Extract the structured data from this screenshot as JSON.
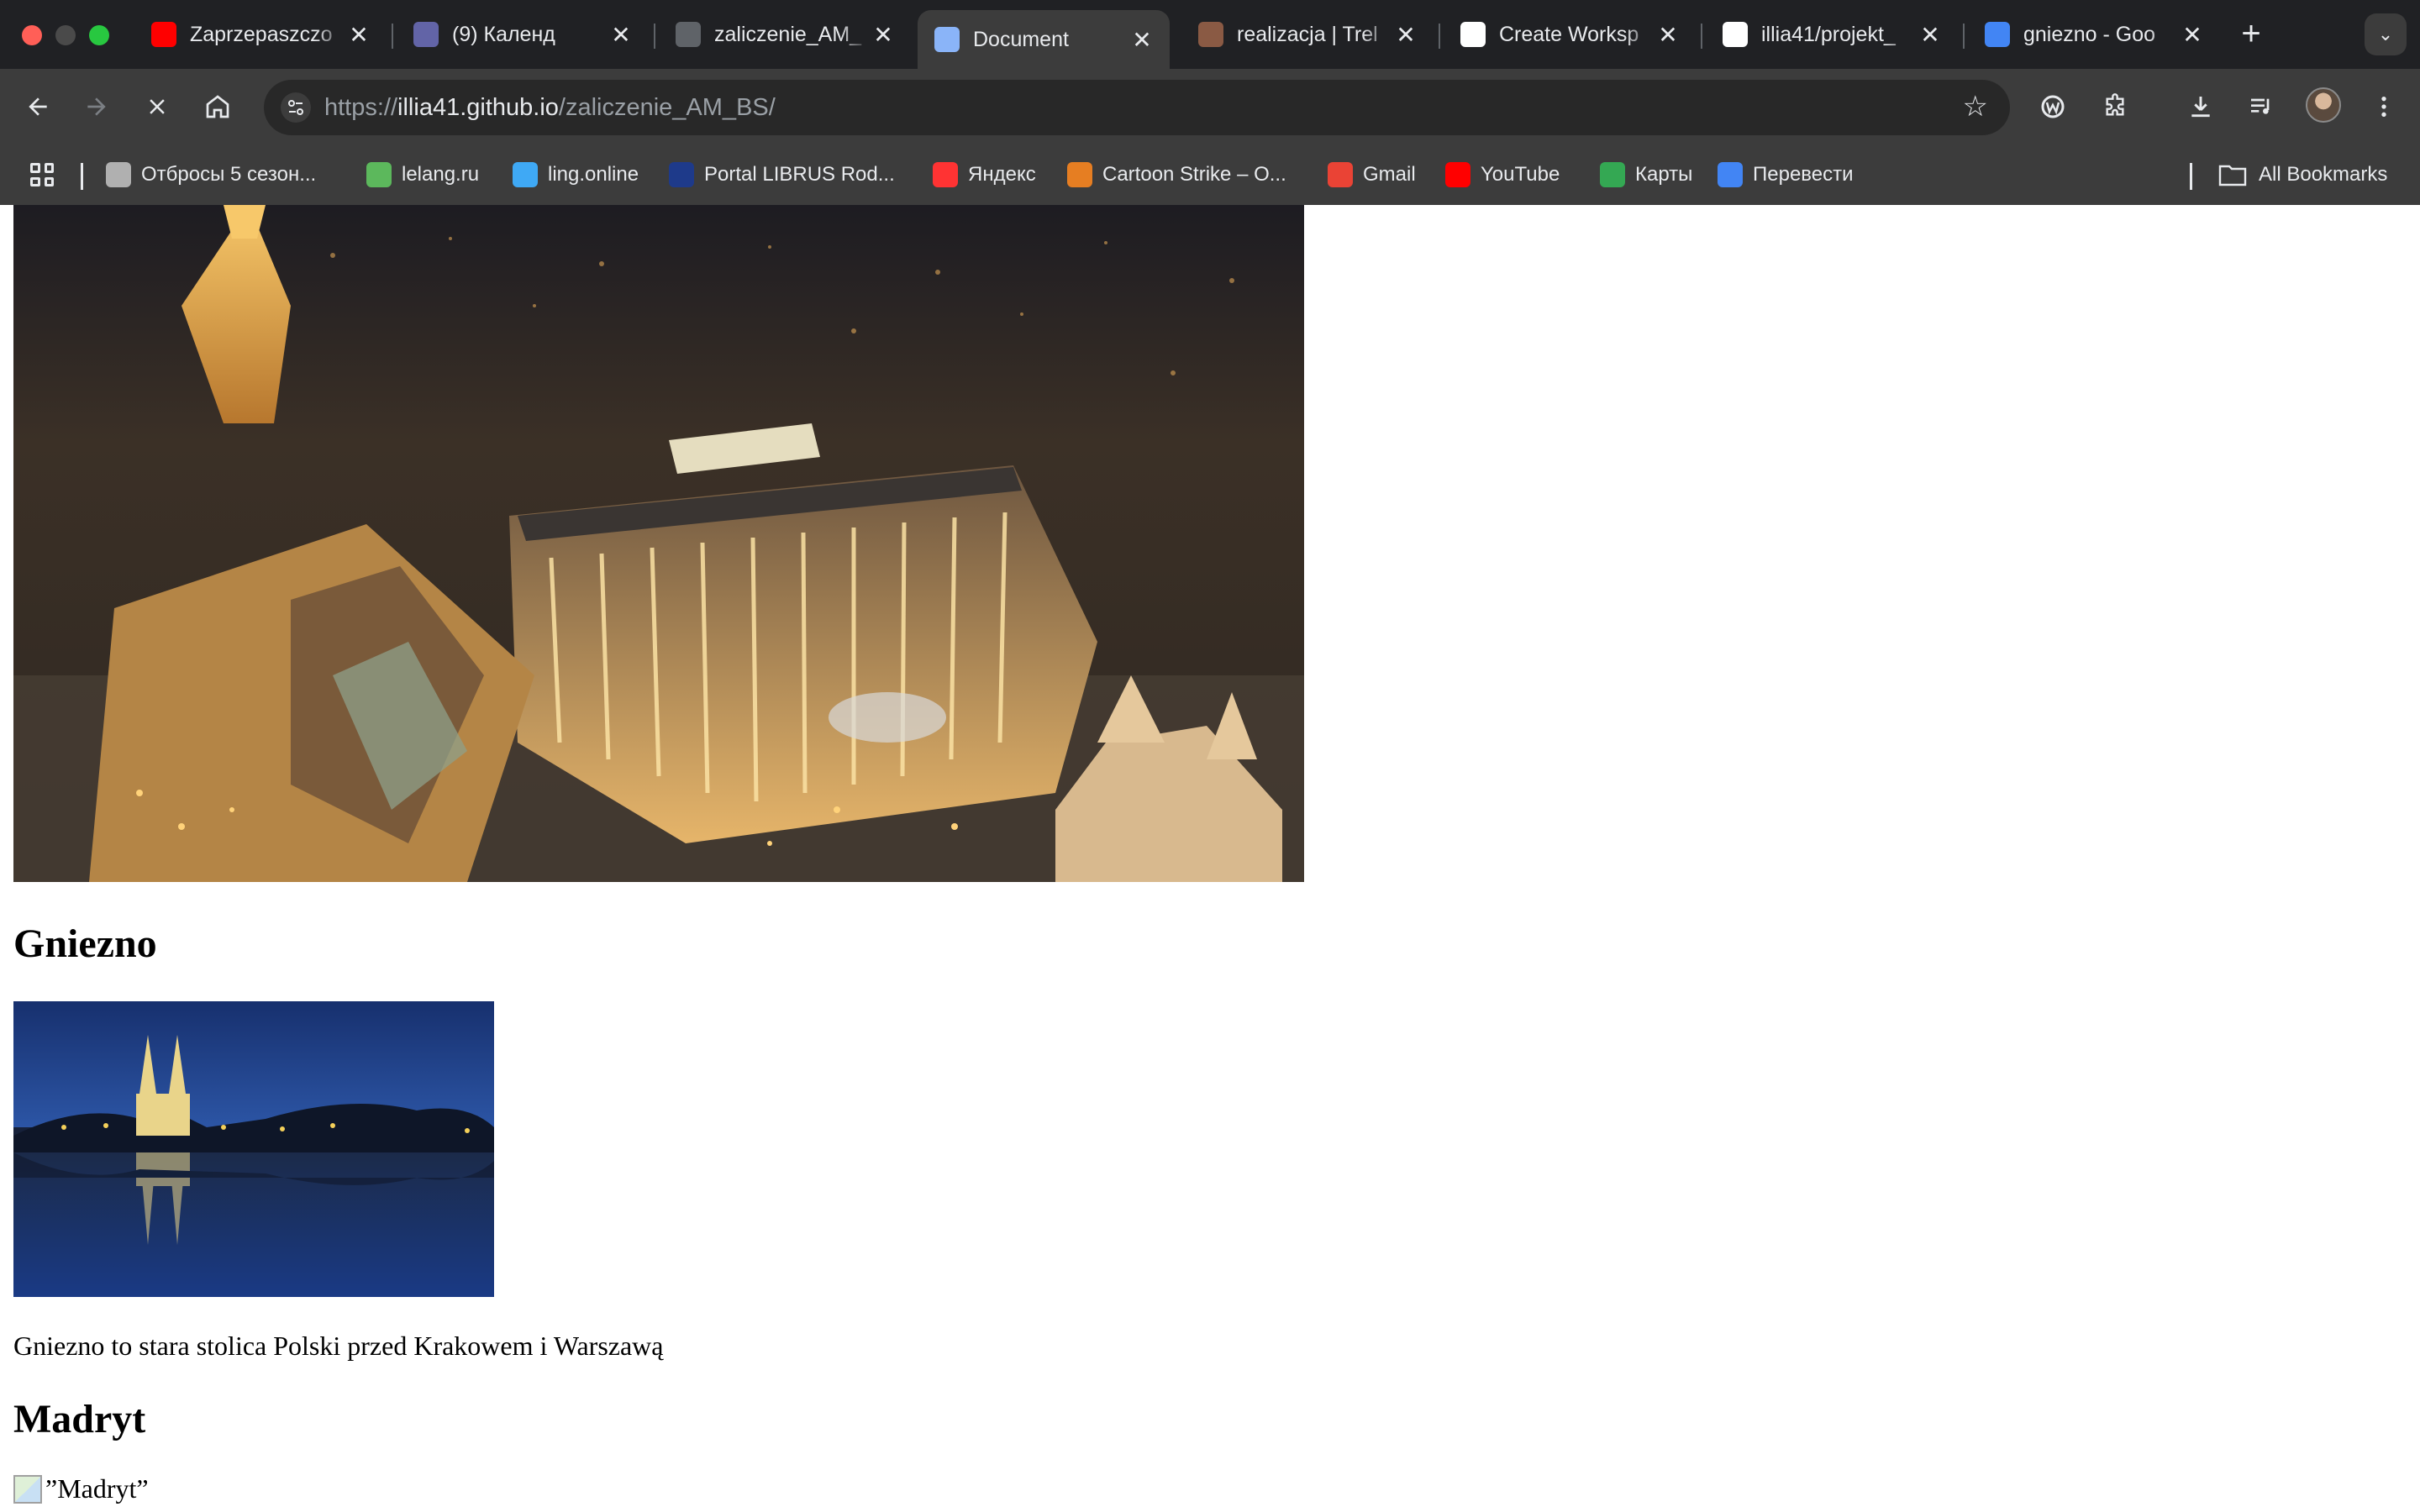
{
  "window": {
    "tabs": [
      {
        "title": "Zaprzepaszczo",
        "icon": "youtube-icon",
        "color": "#ff0000"
      },
      {
        "title": "(9) Календ",
        "icon": "teams-icon",
        "color": "#6264a7"
      },
      {
        "title": "zaliczenie_AM_",
        "icon": "globe-icon",
        "color": "#5f6368"
      },
      {
        "title": "Document",
        "icon": "loading-icon",
        "color": "#8ab4f8",
        "active": true
      },
      {
        "title": "realizacja | Trel",
        "icon": "trello-icon",
        "color": "#8a5a44"
      },
      {
        "title": "Create Worksp",
        "icon": "openai-icon",
        "color": "#ffffff"
      },
      {
        "title": "illia41/projekt_",
        "icon": "github-icon",
        "color": "#ffffff"
      },
      {
        "title": "gniezno - Goo",
        "icon": "google-icon",
        "color": "#4285f4"
      }
    ],
    "close_glyph": "✕",
    "new_tab_glyph": "+",
    "tab_search_glyph": "⌄"
  },
  "toolbar": {
    "url_scheme": "https://",
    "url_host": "illia41.github.io",
    "url_path": "/zaliczenie_AM_BS/"
  },
  "bookmarks": [
    {
      "label": "Отбросы 5 сезон...",
      "icon": "cartoon-icon",
      "color": "#b0b0b0"
    },
    {
      "label": "lelang.ru",
      "icon": "play-icon",
      "color": "#5cb85c"
    },
    {
      "label": "ling.online",
      "icon": "ling-icon",
      "color": "#3fa9f5"
    },
    {
      "label": "Portal LIBRUS Rod...",
      "icon": "librus-icon",
      "color": "#1e3a8a"
    },
    {
      "label": "Яндекс",
      "icon": "yandex-icon",
      "color": "#ff3333"
    },
    {
      "label": "Cartoon Strike – O...",
      "icon": "game-icon",
      "color": "#e67e22"
    },
    {
      "label": "Gmail",
      "icon": "gmail-icon",
      "color": "#ea4335"
    },
    {
      "label": "YouTube",
      "icon": "youtube-icon",
      "color": "#ff0000"
    },
    {
      "label": "Карты",
      "icon": "maps-icon",
      "color": "#34a853"
    },
    {
      "label": "Перевести",
      "icon": "translate-icon",
      "color": "#4285f4"
    }
  ],
  "all_bookmarks_label": "All Bookmarks",
  "page": {
    "heading1": "Gniezno",
    "paragraph1": "Gniezno to stara stolica Polski przed Krakowem i Warszawą",
    "heading2": "Madryt",
    "broken_image_alt": "”Madryt”"
  }
}
